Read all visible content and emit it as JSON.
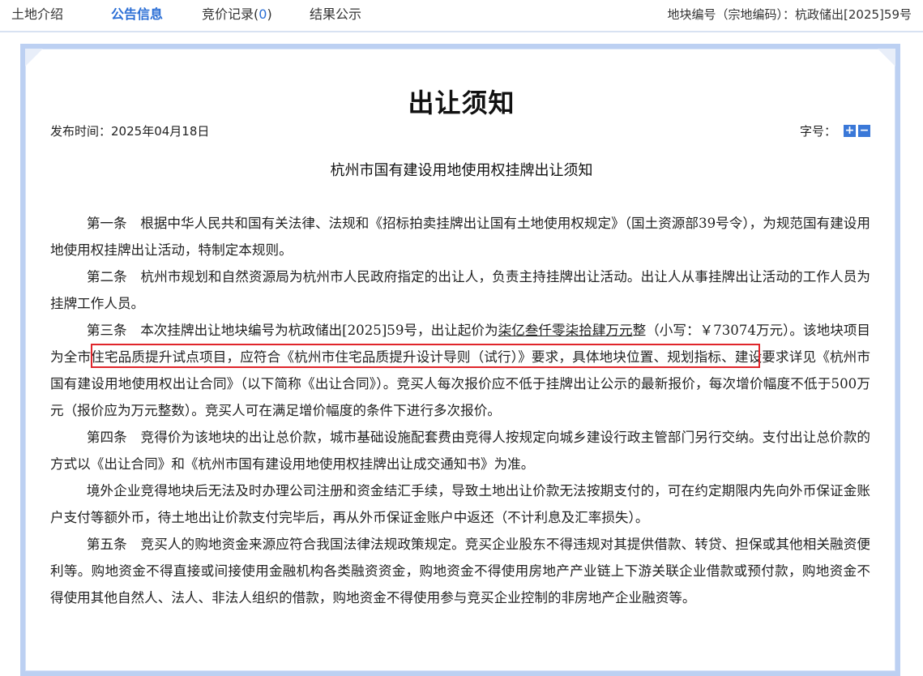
{
  "tabs": {
    "intro": "土地介绍",
    "notice": "公告信息",
    "bid_record_label": "竞价记录(",
    "bid_record_count": "0",
    "bid_record_close": ")",
    "result": "结果公示"
  },
  "parcel": {
    "label": "地块编号（宗地编码）：",
    "code": "杭政储出[2025]59号"
  },
  "document": {
    "title": "出让须知",
    "publish_label": "发布时间：",
    "publish_date": "2025年04月18日",
    "font_size_label": "字号：",
    "font_increase": "+",
    "font_decrease": "−",
    "subtitle": "杭州市国有建设用地使用权挂牌出让须知",
    "art1": "第一条　根据中华人民共和国有关法律、法规和《招标拍卖挂牌出让国有土地使用权规定》（国土资源部39号令），为规范国有建设用地使用权挂牌出让活动，特制定本规则。",
    "art2": "第二条　杭州市规划和自然资源局为杭州市人民政府指定的出让人，负责主持挂牌出让活动。出让人从事挂牌出让活动的工作人员为挂牌工作人员。",
    "art3_a": "第三条　本次挂牌出让地块编号为杭政储出[2025]59号，出让起价为",
    "art3_price_words": "柒亿叁仟零柒拾肆万元",
    "art3_b": "整（小写：￥73074万元）。该地块项目为全市住宅品质提升试点项目，应符合《杭州市住宅品质提升设计导则（试行）》要求，具体地块位置、规划指标、建设要求详见《杭州市国有建设用地使用权出让合同》（以下简称《出让合同》）。竞买人每次报价应不低于挂牌出让公示的最新报价，每次增价幅度不低于500万元（报价应为万元整数）。竞买人可在满足增价幅度的条件下进行多次报价。",
    "art4": "第四条　竞得价为该地块的出让总价款，城市基础设施配套费由竞得人按规定向城乡建设行政主管部门另行交纳。支付出让总价款的方式以《出让合同》和《杭州市国有建设用地使用权挂牌出让成交通知书》为准。",
    "art4_foreign": "境外企业竞得地块后无法及时办理公司注册和资金结汇手续，导致土地出让价款无法按期支付的，可在约定期限内先向外币保证金账户支付等额外币，待土地出让价款支付完毕后，再从外币保证金账户中返还（不计利息及汇率损失）。",
    "art5": "第五条　竞买人的购地资金来源应符合我国法律法规政策规定。竞买企业股东不得违规对其提供借款、转贷、担保或其他相关融资便利等。购地资金不得直接或间接使用金融机构各类融资资金，购地资金不得使用房地产产业链上下游关联企业借款或预付款，购地资金不得使用其他自然人、法人、非法人组织的借款，购地资金不得使用参与竞买企业控制的非房地产企业融资等。"
  },
  "colors": {
    "accent": "#2a6ed5",
    "frame": "#bcd0f2",
    "highlight": "#e0262b"
  }
}
